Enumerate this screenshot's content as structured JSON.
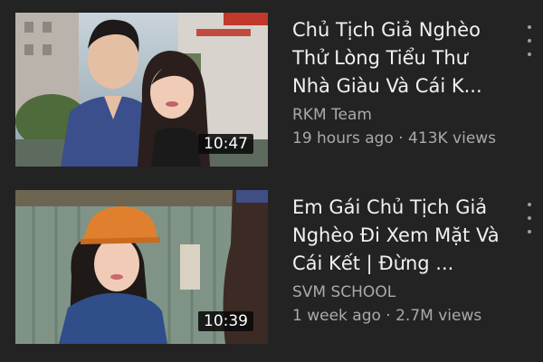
{
  "videos": [
    {
      "title": "Chủ Tịch Giả Nghèo Thử Lòng Tiểu Thư Nhà Giàu Và Cái K...",
      "channel": "RKM Team",
      "stats": "19 hours ago · 413K views",
      "duration": "10:47",
      "more_icon": "more-vert-icon"
    },
    {
      "title": "Em Gái Chủ Tịch Giả Nghèo Đi Xem Mặt Và Cái Kết | Đừng ...",
      "channel": "SVM SCHOOL",
      "stats": "1 week ago · 2.7M views",
      "duration": "10:39",
      "more_icon": "more-vert-icon"
    }
  ],
  "colors": {
    "background": "#232323",
    "title_text": "#f1f1f1",
    "secondary_text": "#aaaaaa"
  }
}
